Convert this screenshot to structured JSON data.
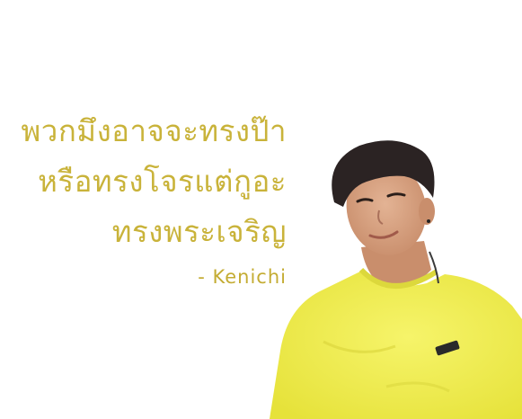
{
  "quote": {
    "lines": [
      "พวกมึงอาจจะทรงป๊า",
      "หรือทรงโจรแต่กูอะ",
      "ทรงพระเจริญ"
    ],
    "author": "-  Kenichi"
  },
  "colors": {
    "quote_text": "#c9b33a",
    "shirt": "#f2f055",
    "hair": "#2b2323",
    "skin": "#d9a584",
    "background": "#ffffff"
  },
  "photo": {
    "subject": "young man in yellow t-shirt"
  }
}
